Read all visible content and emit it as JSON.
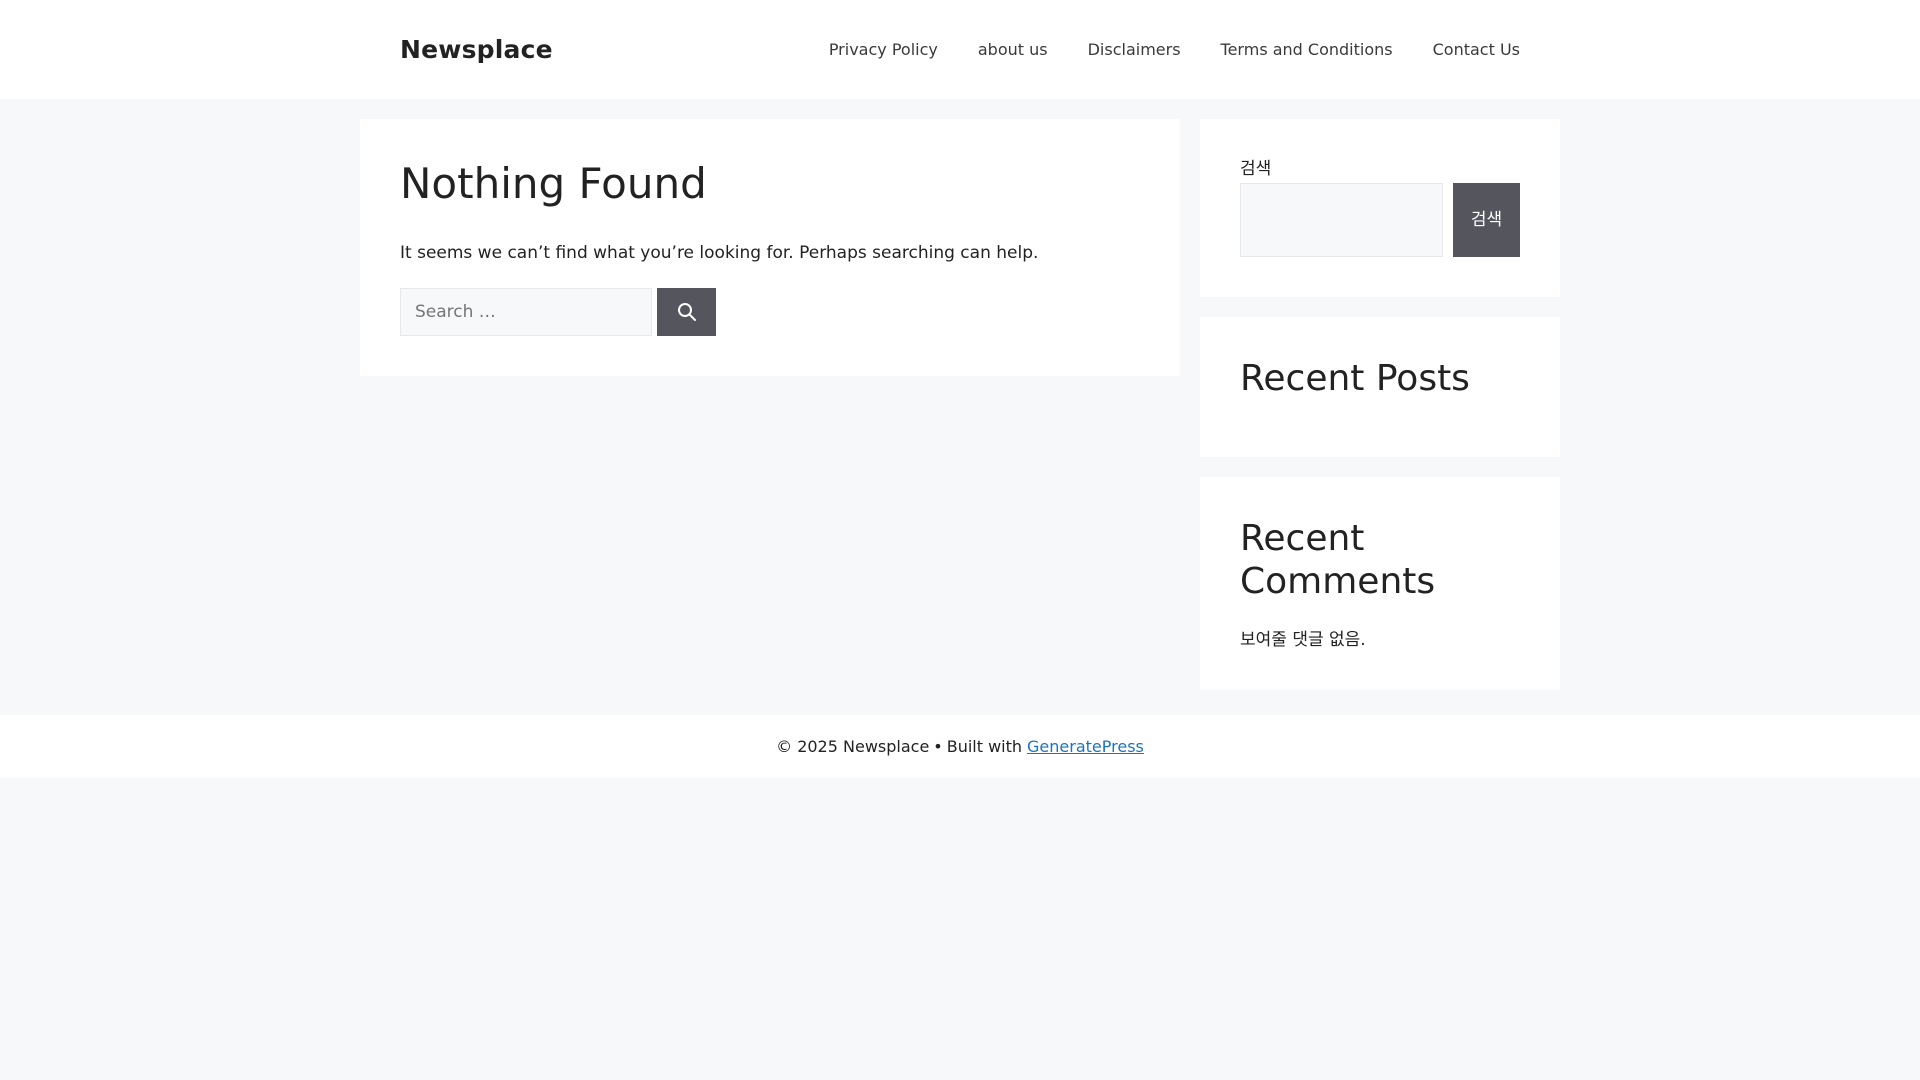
{
  "header": {
    "site_title": "Newsplace",
    "nav": [
      {
        "label": "Privacy Policy"
      },
      {
        "label": "about us"
      },
      {
        "label": "Disclaimers"
      },
      {
        "label": "Terms and Conditions"
      },
      {
        "label": "Contact Us"
      }
    ]
  },
  "main": {
    "title": "Nothing Found",
    "message": "It seems we can’t find what you’re looking for. Perhaps searching can help.",
    "search": {
      "placeholder": "Search …",
      "value": "",
      "button_icon": "search-icon"
    }
  },
  "sidebar": {
    "search_widget": {
      "label": "검색",
      "value": "",
      "button_label": "검색"
    },
    "recent_posts": {
      "title": "Recent Posts"
    },
    "recent_comments": {
      "title": "Recent Comments",
      "empty_text": "보여줄 댓글 없음."
    }
  },
  "footer": {
    "copyright": "© 2025 Newsplace",
    "separator": "•",
    "built_with": "Built with",
    "link_label": "GeneratePress"
  },
  "colors": {
    "page_background": "#f7f8f9",
    "button_background": "#55555e",
    "link": "#1e73be",
    "text": "#222222"
  }
}
